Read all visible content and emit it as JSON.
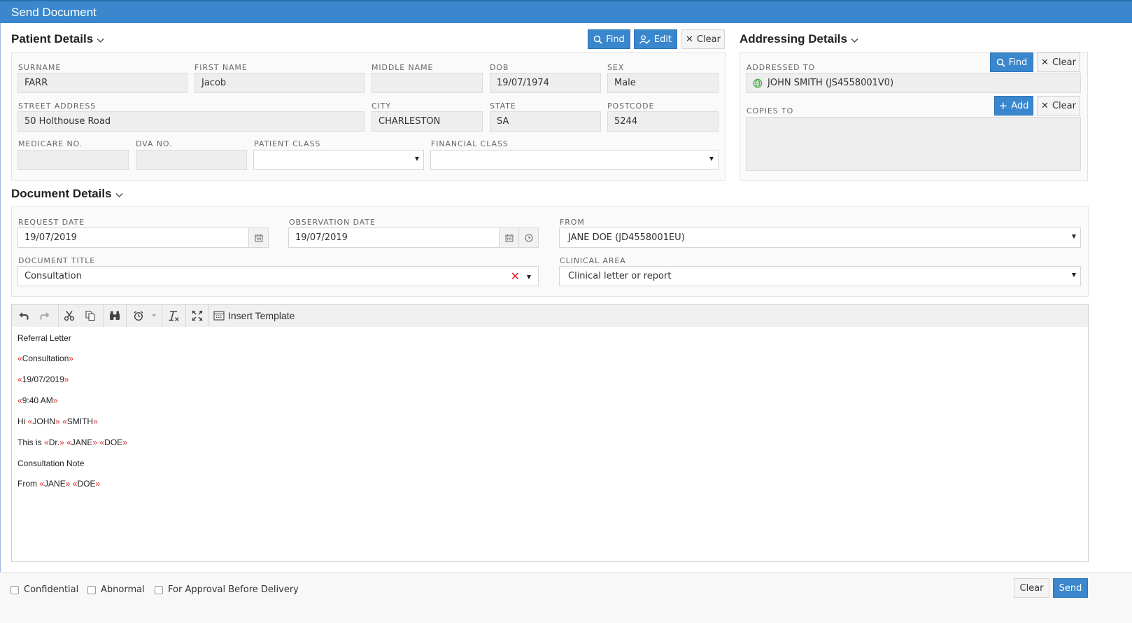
{
  "window": {
    "title": "Send Document"
  },
  "patient": {
    "section_title": "Patient Details",
    "find": "Find",
    "edit": "Edit",
    "clear": "Clear",
    "surname": {
      "label": "SURNAME",
      "value": "FARR"
    },
    "first_name": {
      "label": "FIRST NAME",
      "value": "Jacob"
    },
    "middle_name": {
      "label": "MIDDLE NAME",
      "value": ""
    },
    "dob": {
      "label": "DOB",
      "value": "19/07/1974"
    },
    "sex": {
      "label": "SEX",
      "value": "Male"
    },
    "street": {
      "label": "STREET ADDRESS",
      "value": "50 Holthouse Road"
    },
    "city": {
      "label": "CITY",
      "value": "CHARLESTON"
    },
    "state": {
      "label": "STATE",
      "value": "SA"
    },
    "postcode": {
      "label": "POSTCODE",
      "value": "5244"
    },
    "medicare": {
      "label": "MEDICARE NO.",
      "value": ""
    },
    "dva": {
      "label": "DVA NO.",
      "value": ""
    },
    "patient_class": {
      "label": "PATIENT CLASS",
      "value": ""
    },
    "financial_class": {
      "label": "FINANCIAL CLASS",
      "value": ""
    }
  },
  "addressing": {
    "section_title": "Addressing Details",
    "find": "Find",
    "clear": "Clear",
    "add": "Add",
    "clear2": "Clear",
    "addressed_to": {
      "label": "ADDRESSED TO",
      "value": "JOHN SMITH (JS4558001V0)"
    },
    "copies_to": {
      "label": "COPIES TO"
    }
  },
  "document": {
    "section_title": "Document Details",
    "request_date": {
      "label": "REQUEST DATE",
      "value": "19/07/2019"
    },
    "observation_date": {
      "label": "OBSERVATION DATE",
      "value": "19/07/2019"
    },
    "from": {
      "label": "FROM",
      "value": "JANE DOE (JD4558001EU)"
    },
    "document_title": {
      "label": "DOCUMENT TITLE",
      "value": "Consultation"
    },
    "clinical_area": {
      "label": "CLINICAL AREA",
      "value": "Clinical letter or report"
    }
  },
  "editor": {
    "insert_template": "Insert Template",
    "lines": {
      "l1": "Referral Letter",
      "l2": "Consultation",
      "l3": "19/07/2019",
      "l4": "9:40 AM",
      "l5_prefix": "Hi ",
      "l5_f1": "JOHN",
      "l5_f2": "SMITH",
      "l6_prefix": "This is ",
      "l6_f1": "Dr.",
      "l6_f2": "JANE",
      "l6_f3": "DOE",
      "l7": "Consultation Note",
      "l8_prefix": "From ",
      "l8_f1": "JANE",
      "l8_f2": "DOE"
    }
  },
  "footer": {
    "confidential": "Confidential",
    "abnormal": "Abnormal",
    "approval": "For Approval Before Delivery",
    "clear": "Clear",
    "send": "Send"
  },
  "colors": {
    "primary": "#3a87cd",
    "merge_field": "#dd2222",
    "clear_x": "#e02020"
  }
}
